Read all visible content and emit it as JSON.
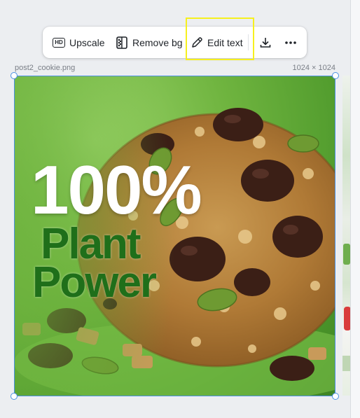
{
  "toolbar": {
    "upscale": {
      "label": "Upscale",
      "icon": "hd-icon",
      "badge": "HD"
    },
    "remove_bg": {
      "label": "Remove bg",
      "icon": "remove-background-icon"
    },
    "edit_text": {
      "label": "Edit text",
      "icon": "pencil-icon",
      "highlighted": true,
      "highlight_color": "#f6f01e"
    },
    "download": {
      "icon": "download-icon"
    },
    "more": {
      "icon": "more-icon"
    }
  },
  "canvas": {
    "file_name": "post2_cookie.png",
    "dimensions": "1024 × 1024",
    "selection_color": "#4a90e2"
  },
  "image": {
    "overlay_line1": "100%",
    "overlay_line2": "Plant",
    "overlay_line3": "Power",
    "line1_color": "#ffffff",
    "line2_color": "#1f6f1a"
  }
}
